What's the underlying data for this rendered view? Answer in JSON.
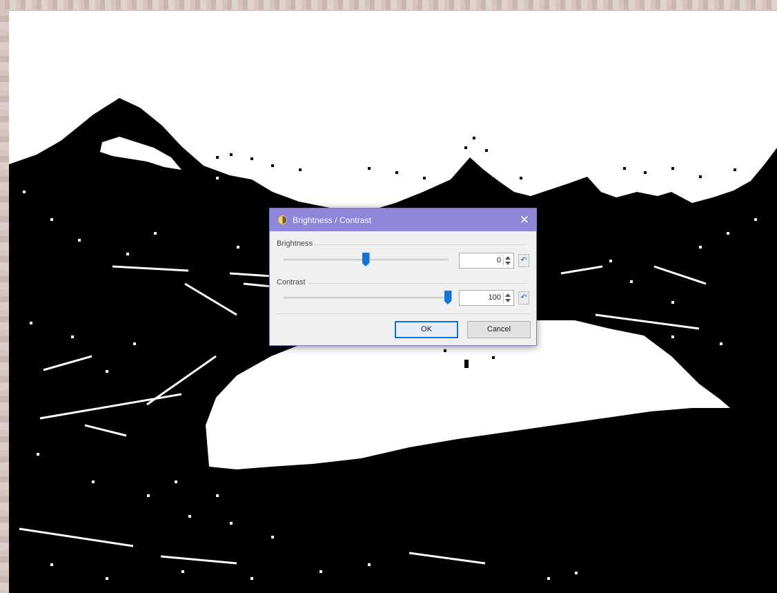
{
  "dialog": {
    "title": "Brightness / Contrast",
    "close_label": "✕",
    "brightness": {
      "label": "Brightness",
      "value": "0",
      "slider_fraction": 0.5
    },
    "contrast": {
      "label": "Contrast",
      "value": "100",
      "slider_fraction": 1.0
    },
    "reset_label": "↶",
    "ok_label": "OK",
    "cancel_label": "Cancel"
  },
  "icons": {
    "title": "brightness-contrast-icon",
    "reset": "reset-icon",
    "spin": "spin-arrows-icon"
  },
  "colors": {
    "titlebar": "#8f85d9",
    "accent": "#1574d6",
    "image_black": "#000000",
    "image_white": "#ffffff"
  }
}
